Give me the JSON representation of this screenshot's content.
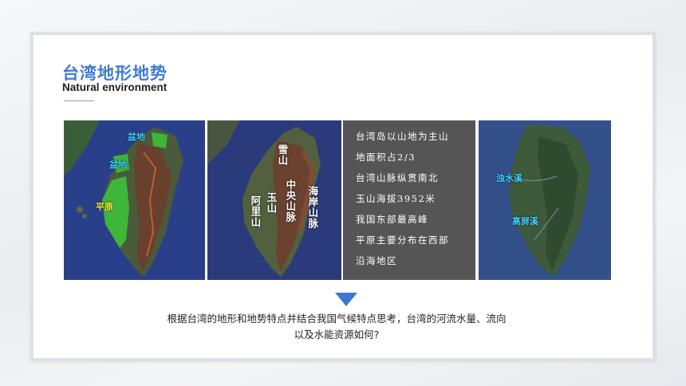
{
  "header": {
    "title": "台湾地形地势",
    "subtitle": "Natural environment"
  },
  "map1": {
    "labels": [
      "盆地",
      "盆地",
      "平原"
    ]
  },
  "map2": {
    "labels": [
      "雪山",
      "中央山脉",
      "海岸山脉",
      "玉山",
      "阿里山"
    ]
  },
  "info_box": {
    "lines": [
      "台湾岛以山地为主山",
      "地面积占2/3",
      "台湾山脉纵贯南北",
      "玉山海拔3952米",
      "我国东部最高峰",
      "平原主要分布在西部",
      "沿海地区"
    ]
  },
  "map4": {
    "labels": [
      "浊水溪",
      "高屏溪"
    ]
  },
  "question": {
    "line1": "根据台湾的地形和地势特点并结合我国气候特点思考，台湾的河流水量、流向",
    "line2": "以及水能资源如何?"
  },
  "colors": {
    "title": "#3f7bd5",
    "arrow": "#3c78d0",
    "info_bg": "#555555",
    "label_cyan": "#3dd0ff",
    "label_yellow": "#f5f23a"
  }
}
